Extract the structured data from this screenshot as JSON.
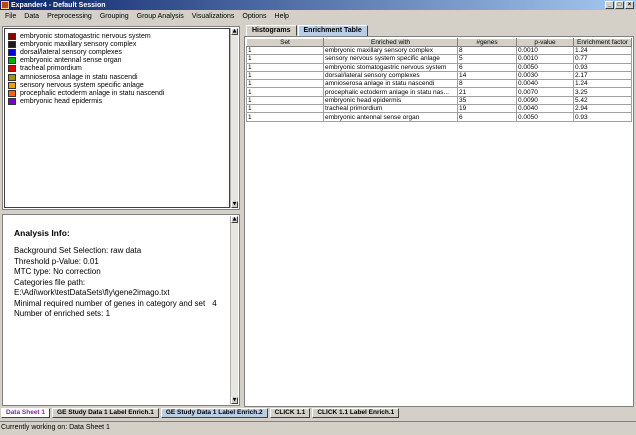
{
  "window": {
    "title": "Expander4 - Default Session",
    "minimize": "_",
    "maximize": "□",
    "close": "×"
  },
  "menu": [
    "File",
    "Data",
    "Preprocessing",
    "Grouping",
    "Group Analysis",
    "Visualizations",
    "Options",
    "Help"
  ],
  "legend": [
    {
      "label": "embryonic stomatogastric nervous system",
      "color": "#8b0000"
    },
    {
      "label": "embryonic maxillary sensory complex",
      "color": "#1a1a1a"
    },
    {
      "label": "dorsal/lateral sensory complexes",
      "color": "#0000e0"
    },
    {
      "label": "embryonic antennal sense organ",
      "color": "#00b000"
    },
    {
      "label": "tracheal primordium",
      "color": "#e00000"
    },
    {
      "label": "amnioserosa anlage in statu nascendi",
      "color": "#9a9a00"
    },
    {
      "label": "sensory nervous system specific anlage",
      "color": "#f0a000"
    },
    {
      "label": "procephalic ectoderm anlage in statu nascendi",
      "color": "#ff6010"
    },
    {
      "label": "embryonic head epidermis",
      "color": "#7a00d0"
    }
  ],
  "analysis": {
    "title": "Analysis Info:",
    "background": "Background Set Selection: raw data",
    "threshold": "Threshold p-Value: 0.01",
    "mtc": "MTC type: No correction",
    "cat_label": "Categories file path:",
    "cat_path": "E:\\Adi\\work\\testDataSets\\fly\\gene2imago.txt",
    "min_req": "Minimal required number of genes in category and set",
    "min_req_value": "4",
    "enriched": "Number of enriched sets: 1"
  },
  "tabs": [
    "Histograms",
    "Enrichment Table"
  ],
  "table": {
    "headers": [
      "Set",
      "Enriched with",
      "#genes",
      "p-value",
      "Enrichment factor"
    ],
    "rows": [
      [
        "1",
        "embryonic maxillary sensory complex",
        "8",
        "0.0010",
        "1.24"
      ],
      [
        "1",
        "sensory nervous system specific anlage",
        "5",
        "0.0010",
        "0.77"
      ],
      [
        "1",
        "embryonic stomatogastric nervous system",
        "6",
        "0.0050",
        "0.93"
      ],
      [
        "1",
        "dorsal/lateral sensory complexes",
        "14",
        "0.0030",
        "2.17"
      ],
      [
        "1",
        "amnioserosa anlage in statu nascendi",
        "8",
        "0.0040",
        "1.24"
      ],
      [
        "1",
        "procephalic ectoderm anlage in statu nas...",
        "21",
        "0.0070",
        "3.25"
      ],
      [
        "1",
        "embryonic head epidermis",
        "35",
        "0.0090",
        "5.42"
      ],
      [
        "1",
        "tracheal primordium",
        "19",
        "0.0040",
        "2.94"
      ],
      [
        "1",
        "embryonic antennal sense organ",
        "6",
        "0.0050",
        "0.93"
      ]
    ]
  },
  "sheet_tabs": [
    "Data Sheet 1",
    "GE Study Data 1 Label Enrich.1",
    "GE Study Data 1 Label Enrich.2",
    "CLICK 1.1",
    "CLICK 1.1 Label Enrich.1"
  ],
  "status": "Currently working on: Data Sheet 1",
  "icons": {
    "scroll_up": "▲",
    "scroll_down": "▼"
  }
}
